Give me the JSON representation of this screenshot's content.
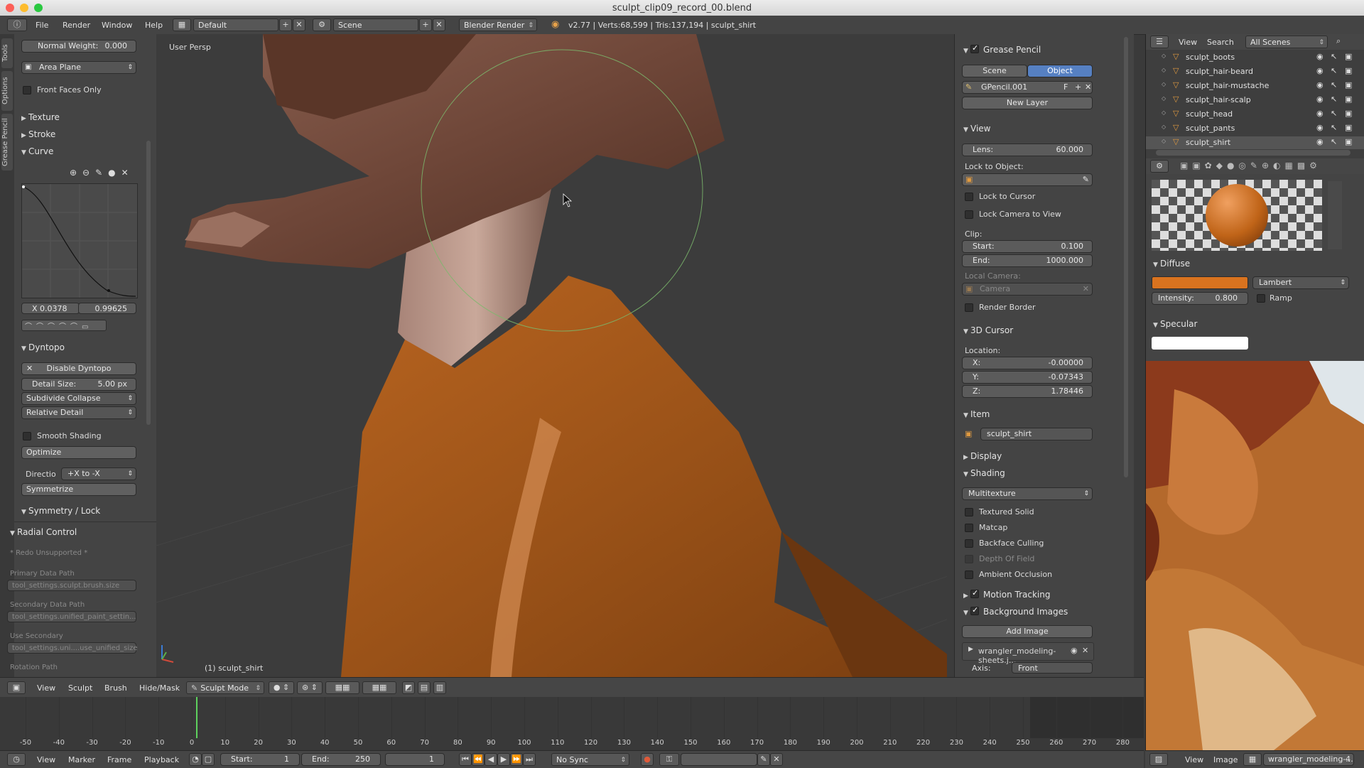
{
  "window": {
    "title": "sculpt_clip09_record_00.blend"
  },
  "info_header": {
    "menus": [
      "File",
      "Render",
      "Window",
      "Help"
    ],
    "layout": "Default",
    "scene": "Scene",
    "engine": "Blender Render",
    "stats": "v2.77 | Verts:68,599 | Tris:137,194 | sculpt_shirt"
  },
  "left_tabs": [
    "Tools",
    "Options",
    "Grease Pencil"
  ],
  "tool_shelf": {
    "normal_weight_label": "Normal Weight:",
    "normal_weight_value": "0.000",
    "area_plane": "Area Plane",
    "front_faces_only": "Front Faces Only",
    "texture": "Texture",
    "stroke": "Stroke",
    "curve": "Curve",
    "curve_x": "X 0.0378",
    "curve_y": "0.99625",
    "dyntopo": "Dyntopo",
    "disable_dyntopo": "Disable Dyntopo",
    "detail_size_label": "Detail Size:",
    "detail_size_value": "5.00 px",
    "subdivide_collapse": "Subdivide Collapse",
    "relative_detail": "Relative Detail",
    "smooth_shading": "Smooth Shading",
    "optimize": "Optimize",
    "direction_label": "Directio",
    "direction_value": "+X to -X",
    "symmetrize": "Symmetrize",
    "symmetry_lock": "Symmetry / Lock",
    "radial_control": "Radial Control",
    "redo_unsupported": "* Redo Unsupported *",
    "primary_data_path": "Primary Data Path",
    "primary_value": "tool_settings.sculpt.brush.size",
    "secondary_data_path": "Secondary Data Path",
    "secondary_value": "tool_settings.unified_paint_settin...",
    "use_secondary": "Use Secondary",
    "use_secondary_value": "tool_settings.uni....use_unified_size",
    "rotation_path": "Rotation Path"
  },
  "viewport": {
    "view_label": "User Persp",
    "object_label": "(1) sculpt_shirt"
  },
  "properties": {
    "grease_pencil": "Grease Pencil",
    "scene_tab": "Scene",
    "object_tab": "Object",
    "gpencil_name": "GPencil.001",
    "gpencil_f": "F",
    "new_layer": "New Layer",
    "view": "View",
    "lens_label": "Lens:",
    "lens_value": "60.000",
    "lock_to_object": "Lock to Object:",
    "lock_to_cursor": "Lock to Cursor",
    "lock_camera_to_view": "Lock Camera to View",
    "clip": "Clip:",
    "clip_start_label": "Start:",
    "clip_start_value": "0.100",
    "clip_end_label": "End:",
    "clip_end_value": "1000.000",
    "local_camera": "Local Camera:",
    "camera": "Camera",
    "render_border": "Render Border",
    "cursor_3d": "3D Cursor",
    "location": "Location:",
    "x_label": "X:",
    "x_value": "-0.00000",
    "y_label": "Y:",
    "y_value": "-0.07343",
    "z_label": "Z:",
    "z_value": "1.78446",
    "item": "Item",
    "item_name": "sculpt_shirt",
    "display": "Display",
    "shading": "Shading",
    "shading_mode": "Multitexture",
    "textured_solid": "Textured Solid",
    "matcap": "Matcap",
    "backface_culling": "Backface Culling",
    "depth_of_field": "Depth Of Field",
    "ambient_occlusion": "Ambient Occlusion",
    "motion_tracking": "Motion Tracking",
    "background_images": "Background Images",
    "add_image": "Add Image",
    "bg_image_name": "wrangler_modeling-sheets.j...",
    "axis_label": "Axis:",
    "axis_value": "Front"
  },
  "outliner": {
    "menus": [
      "View",
      "Search"
    ],
    "scenes": "All Scenes",
    "items": [
      "sculpt_boots",
      "sculpt_hair-beard",
      "sculpt_hair-mustache",
      "sculpt_hair-scalp",
      "sculpt_head",
      "sculpt_pants",
      "sculpt_shirt"
    ]
  },
  "material": {
    "diffuse": "Diffuse",
    "diffuse_color": "#d9731f",
    "shader": "Lambert",
    "intensity_label": "Intensity:",
    "intensity_value": "0.800",
    "ramp": "Ramp",
    "specular": "Specular"
  },
  "view3d_header": {
    "menus": [
      "View",
      "Sculpt",
      "Brush",
      "Hide/Mask"
    ],
    "mode": "Sculpt Mode"
  },
  "timeline": {
    "ticks": [
      "-50",
      "-40",
      "-30",
      "-20",
      "-10",
      "0",
      "10",
      "20",
      "30",
      "40",
      "50",
      "60",
      "70",
      "80",
      "90",
      "100",
      "110",
      "120",
      "130",
      "140",
      "150",
      "160",
      "170",
      "180",
      "190",
      "200",
      "210",
      "220",
      "230",
      "240",
      "250",
      "260",
      "270",
      "280"
    ],
    "menus": [
      "View",
      "Marker",
      "Frame",
      "Playback"
    ],
    "start_label": "Start:",
    "start_value": "1",
    "end_label": "End:",
    "end_value": "250",
    "current_frame": "1",
    "sync": "No Sync"
  },
  "image_header": {
    "menus": [
      "View",
      "Image"
    ],
    "image_name": "wrangler_modeling-...",
    "slot": "4"
  }
}
